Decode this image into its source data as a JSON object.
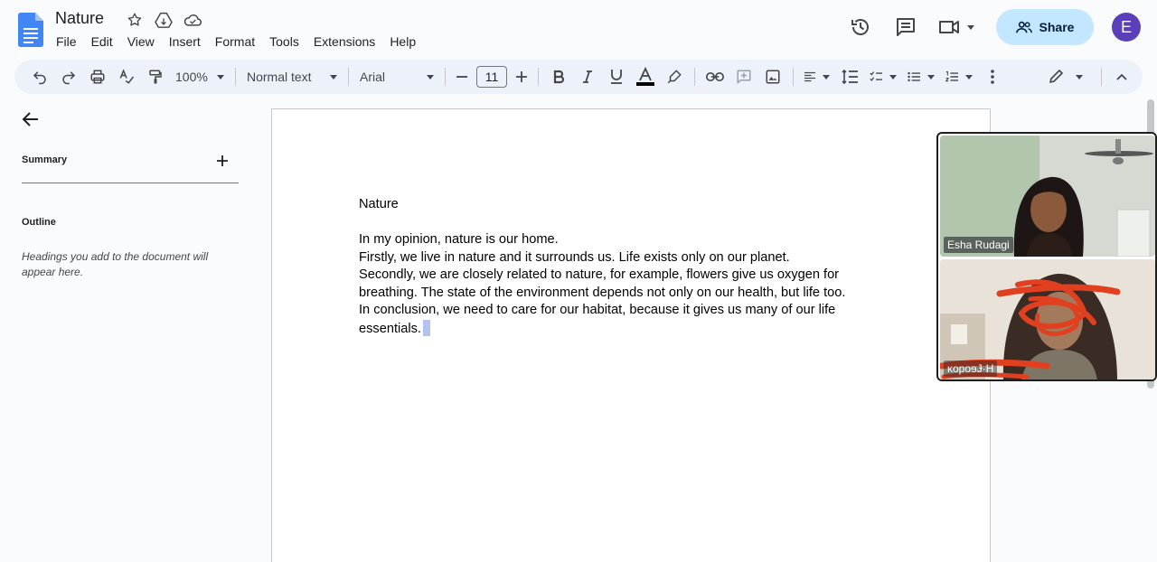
{
  "doc": {
    "title": "Nature",
    "heading": "Nature",
    "paragraph_lines": [
      "In my opinion, nature is our home.",
      "Firstly, we live in nature and it surrounds us. Life exists only on our planet.",
      "Secondly, we are closely related to nature, for example, flowers give us oxygen for",
      "breathing. The state of the environment depends not only on our health, but life too.",
      "In conclusion, we need to care for our habitat, because it gives us many of our life",
      "essentials."
    ]
  },
  "menu": [
    "File",
    "Edit",
    "View",
    "Insert",
    "Format",
    "Tools",
    "Extensions",
    "Help"
  ],
  "header": {
    "share_label": "Share",
    "avatar_letter": "E"
  },
  "toolbar": {
    "zoom": "100%",
    "style": "Normal text",
    "font": "Arial",
    "font_size": "11",
    "text_color": "#000000"
  },
  "outline_panel": {
    "summary_label": "Summary",
    "outline_label": "Outline",
    "outline_hint": "Headings you add to the document will appear here."
  },
  "video": {
    "participant1_name": "Esha Rudagi",
    "participant2_name": "ĸopoɘɈ·Н"
  },
  "colors": {
    "accent_share": "#c2e7ff",
    "avatar_bg": "#5a3fb8",
    "toolbar_bg": "#edf2fa",
    "docs_blue": "#4285f4"
  },
  "icons": [
    "docs-logo",
    "star-icon",
    "move-to-drive-icon",
    "cloud-saved-icon",
    "history-icon",
    "comment-icon",
    "meet-icon",
    "undo-icon",
    "redo-icon",
    "print-icon",
    "spellcheck-icon",
    "paint-format-icon",
    "bold-icon",
    "italic-icon",
    "underline-icon",
    "text-color-icon",
    "highlight-icon",
    "link-icon",
    "add-comment-icon",
    "image-icon",
    "align-icon",
    "line-spacing-icon",
    "checklist-icon",
    "bullet-list-icon",
    "numbered-list-icon",
    "more-icon",
    "edit-mode-icon",
    "collapse-icon",
    "back-arrow-icon",
    "plus-icon"
  ]
}
